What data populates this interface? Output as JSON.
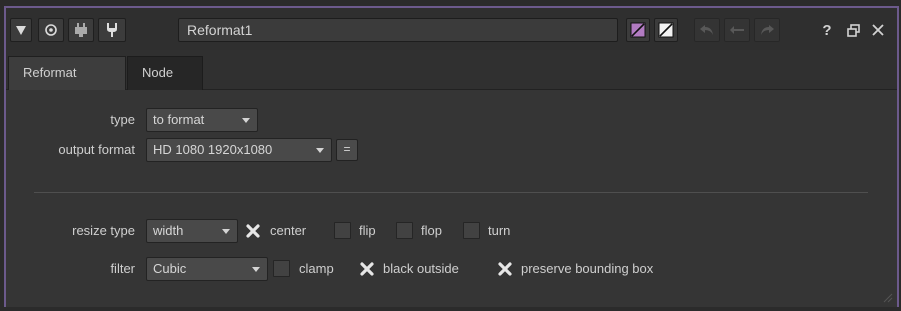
{
  "node": {
    "name": "Reformat1"
  },
  "tabs": [
    {
      "label": "Reformat",
      "active": true
    },
    {
      "label": "Node",
      "active": false
    }
  ],
  "titlebar": {
    "help_label": "?"
  },
  "fields": {
    "type": {
      "label": "type",
      "value": "to format"
    },
    "output_format": {
      "label": "output format",
      "value": "HD 1080 1920x1080",
      "extra_button": "="
    },
    "resize_type": {
      "label": "resize type",
      "value": "width"
    },
    "filter": {
      "label": "filter",
      "value": "Cubic"
    }
  },
  "options_row1": [
    {
      "label": "center",
      "checked": true
    },
    {
      "label": "flip",
      "checked": false
    },
    {
      "label": "flop",
      "checked": false
    },
    {
      "label": "turn",
      "checked": false
    }
  ],
  "options_row2": [
    {
      "label": "clamp",
      "checked": false
    },
    {
      "label": "black outside",
      "checked": true
    },
    {
      "label": "preserve bounding box",
      "checked": true
    }
  ],
  "colors": {
    "accent": "#6c5a8c",
    "panel": "#353535"
  }
}
